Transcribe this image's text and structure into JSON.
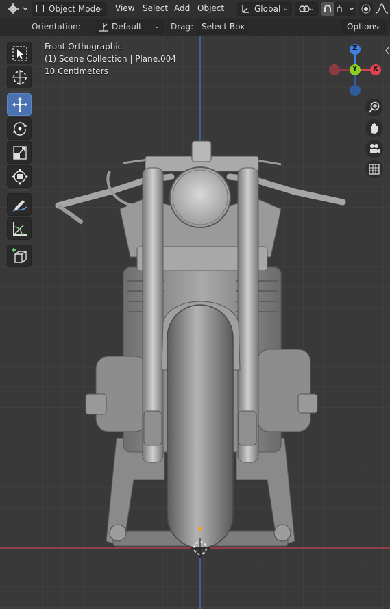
{
  "header": {
    "mode_label": "Object Mode",
    "menus": [
      "View",
      "Select",
      "Add",
      "Object"
    ],
    "transform_orientation": "Global"
  },
  "subheader": {
    "orientation_label": "Orientation:",
    "orientation_value": "Default",
    "drag_label": "Drag:",
    "drag_value": "Select Box",
    "options_label": "Options"
  },
  "viewport": {
    "view_name": "Front Orthographic",
    "collection_info": "(1) Scene Collection | Plane.004",
    "grid_scale": "10 Centimeters"
  },
  "gizmo": {
    "axes": [
      "Z",
      "Y",
      "X"
    ],
    "colors": {
      "x": "#e0434f",
      "y": "#8ccf24",
      "z": "#3f7fe0",
      "neg_x": "#8f3a43",
      "neg_z": "#2f5c9c"
    }
  },
  "toolbar": {
    "tools": [
      "select-box-icon",
      "cursor-icon",
      "move-icon",
      "rotate-icon",
      "scale-icon",
      "transform-icon",
      "annotate-icon",
      "measure-icon",
      "add-cube-icon"
    ],
    "active_tool": "move-icon"
  },
  "nav": [
    "zoom-icon",
    "hand-pan-icon",
    "camera-icon",
    "grid-toggle-icon"
  ],
  "colors": {
    "accent": "#4a72b0",
    "axis_red": "#c8424e",
    "axis_blue": "#4a7bd4",
    "background": "#393939"
  }
}
